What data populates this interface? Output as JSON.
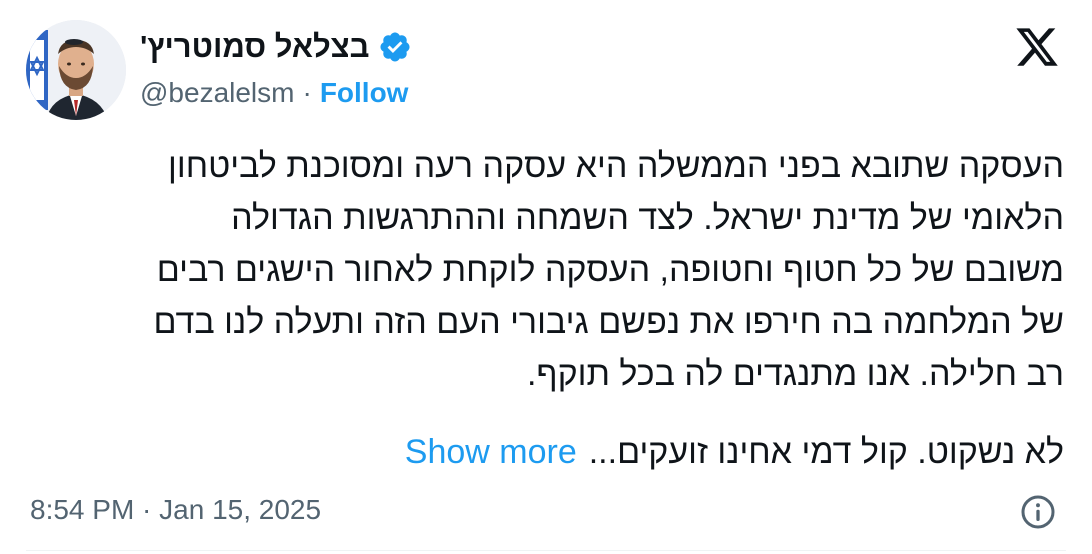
{
  "author": {
    "display_name": "בצלאל סמוטריץ'",
    "handle": "@bezalelsm",
    "separator": "·",
    "follow_label": "Follow",
    "verified_icon": "verified-badge-icon",
    "verified_color": "#1d9bf0"
  },
  "platform_icon": "x-logo-icon",
  "tweet": {
    "text": "העסקה שתובא בפני הממשלה היא עסקה רעה ומסוכנת לביטחון\nהלאומי של מדינת ישראל. לצד השמחה וההתרגשות הגדולה\nמשובם של כל חטוף וחטופה, העסקה לוקחת לאחור הישגים רבים\nשל המלחמה בה חירפו את נפשם גיבורי העם הזה ותעלה לנו בדם\nרב חלילה. אנו מתנגדים לה בכל תוקף.",
    "last_line": "לא נשקוט. קול דמי אחינו זועקים...",
    "show_more_label": "Show more"
  },
  "footer": {
    "timestamp": "8:54 PM · Jan 15, 2025",
    "info_icon": "info-icon"
  },
  "colors": {
    "accent": "#1d9bf0",
    "text": "#0f1419",
    "secondary": "#536471"
  }
}
